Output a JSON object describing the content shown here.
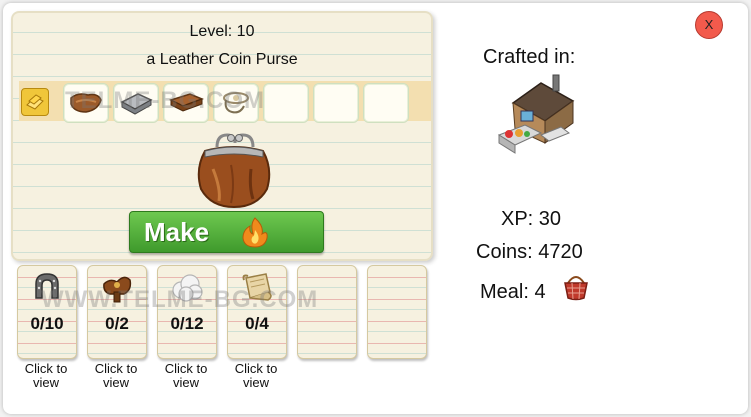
{
  "dialog": {
    "close_label": "X",
    "level_text": "Level: 10",
    "item_name": "a Leather Coin Purse",
    "make_label": "Make"
  },
  "ingredients": [
    {
      "icon": "leather-icon"
    },
    {
      "icon": "metal-sheets-icon"
    },
    {
      "icon": "leather-strips-icon"
    },
    {
      "icon": "wire-clasp-icon"
    },
    {
      "icon": "empty-slot"
    },
    {
      "icon": "empty-slot"
    },
    {
      "icon": "empty-slot"
    }
  ],
  "requirements": [
    {
      "icon": "horseshoe-icon",
      "count": "0/10",
      "link": "Click to view"
    },
    {
      "icon": "saddle-icon",
      "count": "0/2",
      "link": "Click to view"
    },
    {
      "icon": "wool-icon",
      "count": "0/12",
      "link": "Click to view"
    },
    {
      "icon": "scroll-icon",
      "count": "0/4",
      "link": "Click to view"
    },
    {
      "icon": "empty",
      "count": "",
      "link": ""
    },
    {
      "icon": "empty",
      "count": "",
      "link": ""
    }
  ],
  "info": {
    "crafted_in_label": "Crafted in:",
    "xp": "XP: 30",
    "coins": "Coins: 4720",
    "meal": "Meal: 4"
  },
  "watermark": "TELME-BG.COM",
  "watermark_large": "WWW.TELME-BG.COM"
}
